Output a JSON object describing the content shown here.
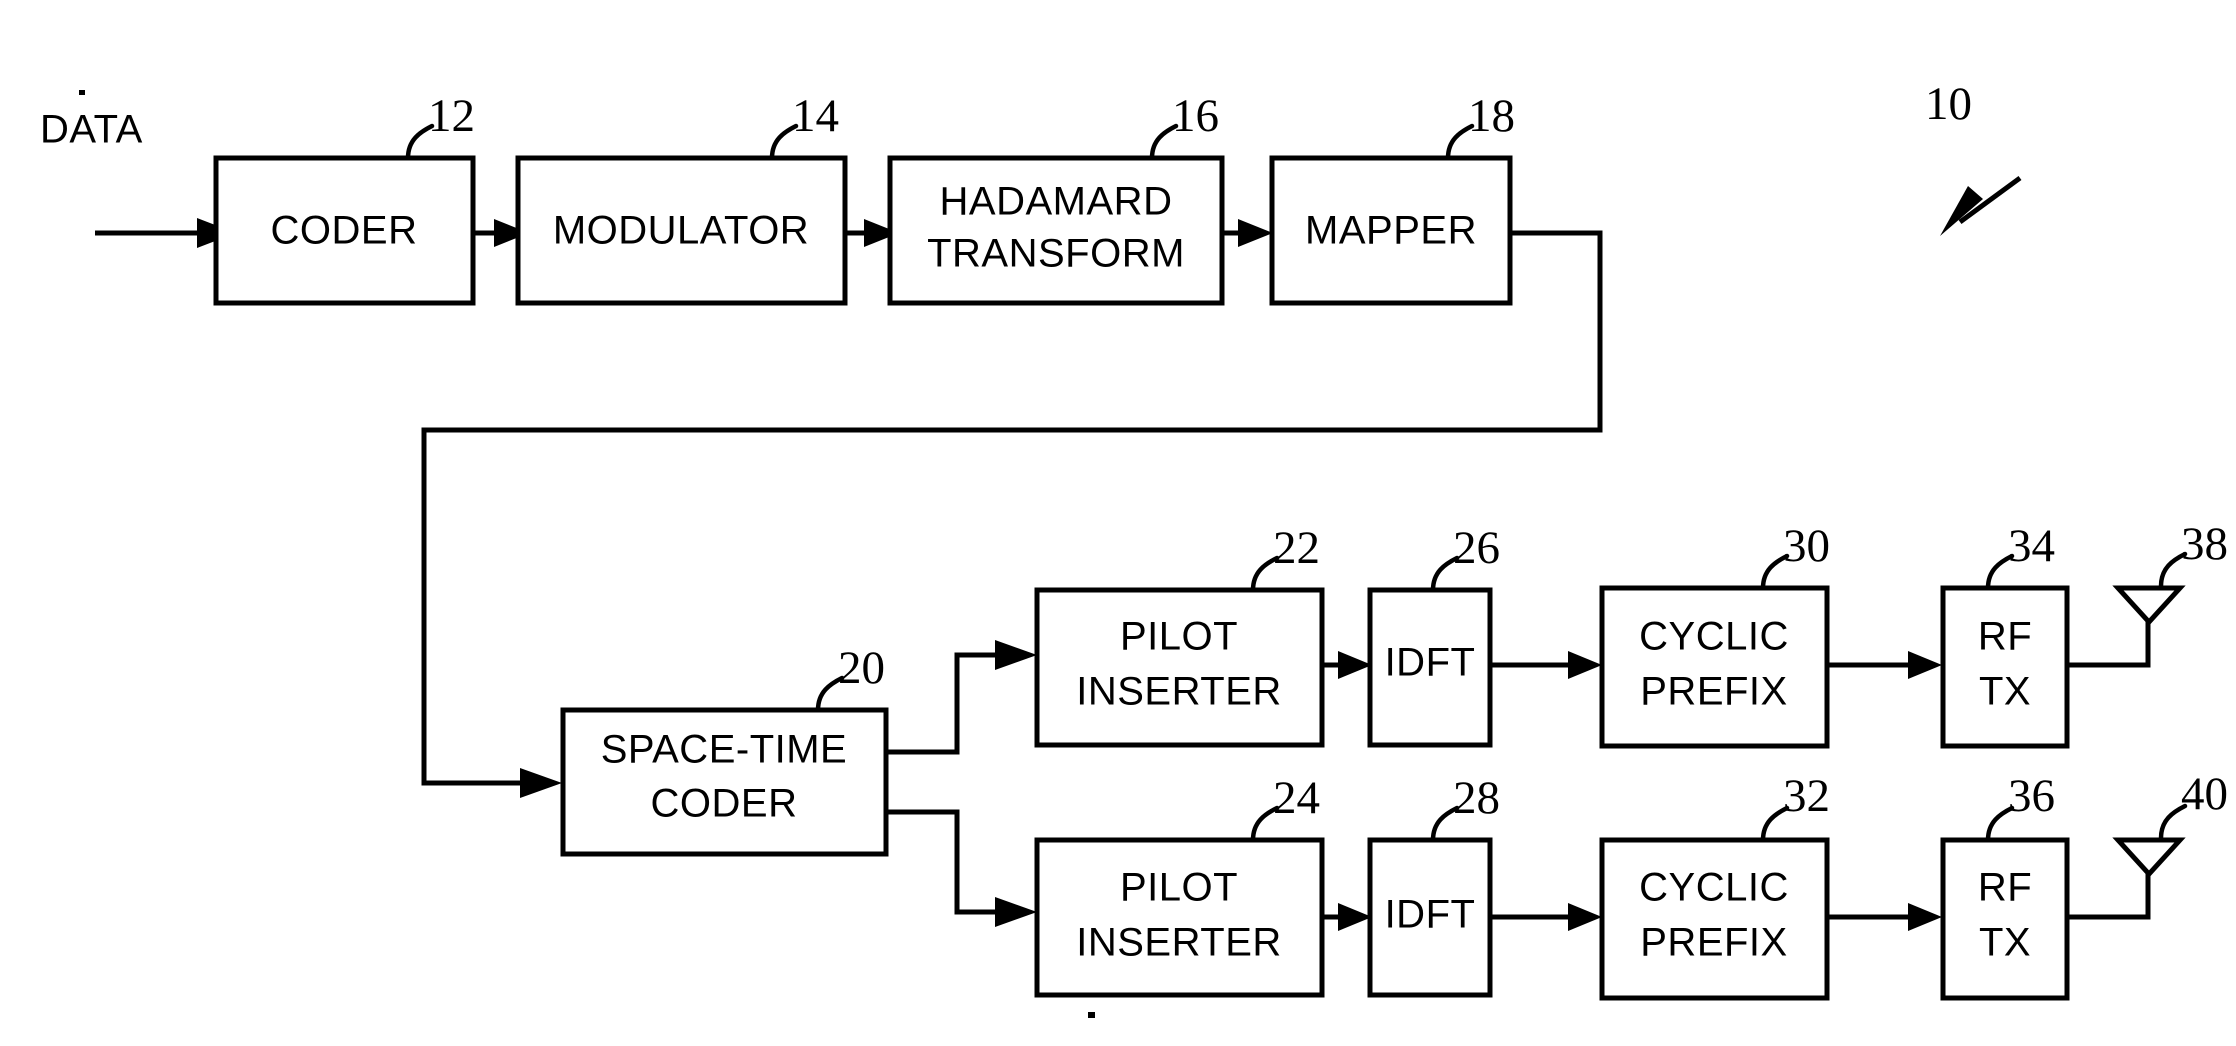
{
  "figure": {
    "assembly_ref": "10",
    "input_label": "DATA",
    "background_color": "#ffffff",
    "line_color": "#000000"
  },
  "blocks": [
    {
      "id": "coder",
      "label_line1": "CODER",
      "label_line2": "",
      "ref": "12"
    },
    {
      "id": "modulator",
      "label_line1": "MODULATOR",
      "label_line2": "",
      "ref": "14"
    },
    {
      "id": "hadamard",
      "label_line1": "HADAMARD",
      "label_line2": "TRANSFORM",
      "ref": "16"
    },
    {
      "id": "mapper",
      "label_line1": "MAPPER",
      "label_line2": "",
      "ref": "18"
    },
    {
      "id": "space_time",
      "label_line1": "SPACE-TIME",
      "label_line2": "CODER",
      "ref": "20"
    },
    {
      "id": "pilot_top",
      "label_line1": "PILOT",
      "label_line2": "INSERTER",
      "ref": "22"
    },
    {
      "id": "idft_top",
      "label_line1": "IDFT",
      "label_line2": "",
      "ref": "26"
    },
    {
      "id": "cyclic_top",
      "label_line1": "CYCLIC",
      "label_line2": "PREFIX",
      "ref": "30"
    },
    {
      "id": "rftx_top",
      "label_line1": "RF",
      "label_line2": "TX",
      "ref": "34"
    },
    {
      "id": "pilot_bot",
      "label_line1": "PILOT",
      "label_line2": "INSERTER",
      "ref": "24"
    },
    {
      "id": "idft_bot",
      "label_line1": "IDFT",
      "label_line2": "",
      "ref": "28"
    },
    {
      "id": "cyclic_bot",
      "label_line1": "CYCLIC",
      "label_line2": "PREFIX",
      "ref": "32"
    },
    {
      "id": "rftx_bot",
      "label_line1": "RF",
      "label_line2": "TX",
      "ref": "36"
    }
  ],
  "antennas": [
    {
      "id": "antenna_top",
      "ref": "38"
    },
    {
      "id": "antenna_bot",
      "ref": "40"
    }
  ]
}
